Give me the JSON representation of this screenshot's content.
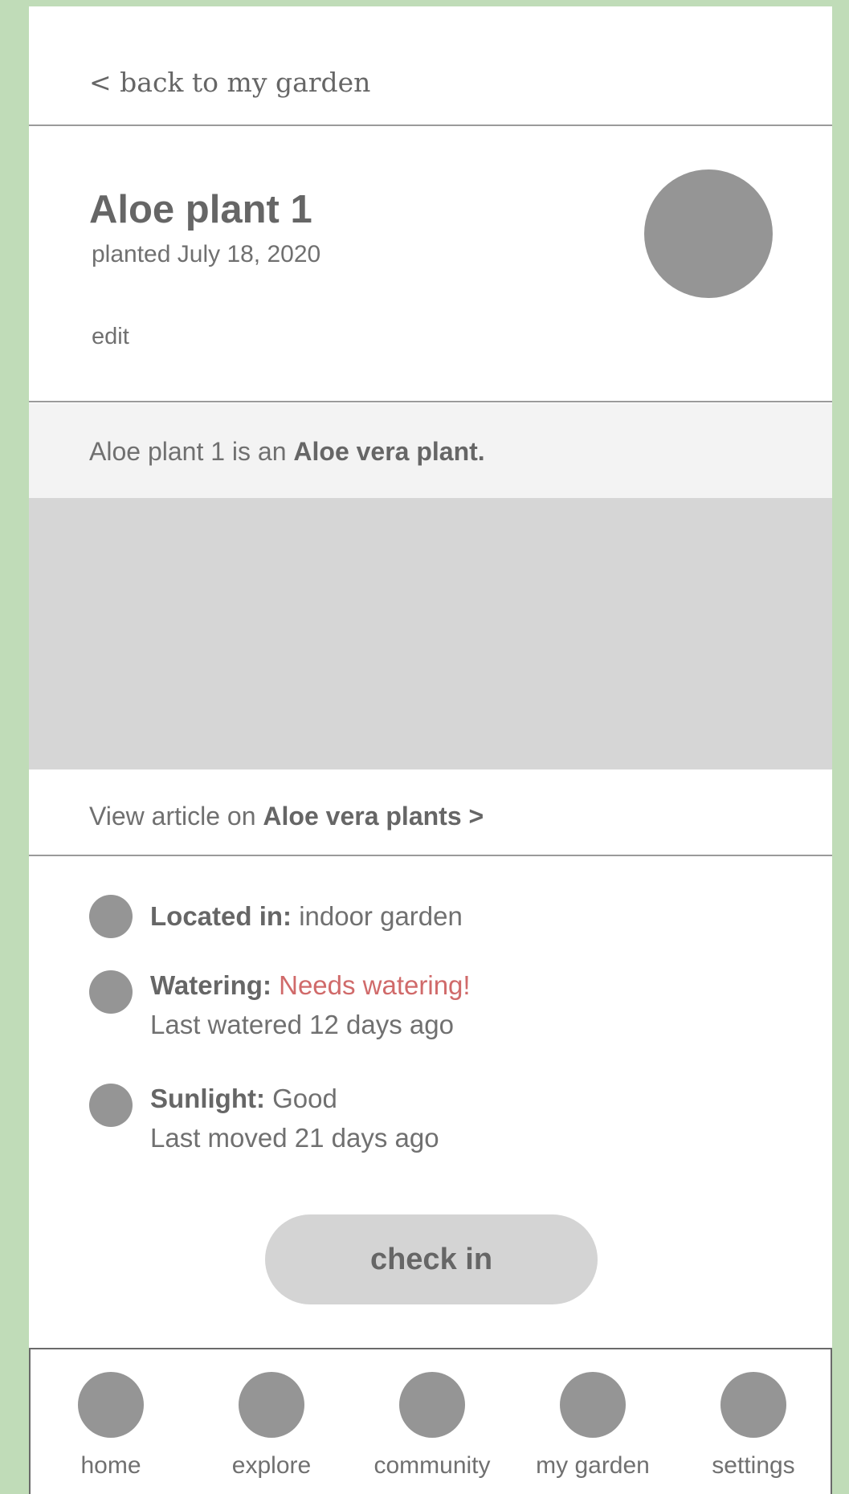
{
  "nav_back": {
    "label": "< back to my garden"
  },
  "plant": {
    "name": "Aloe plant 1",
    "planted": "planted July 18, 2020",
    "edit_label": "edit",
    "species_prefix": "Aloe plant 1 is an",
    "species": "Aloe vera plant."
  },
  "article": {
    "prefix": "View article on",
    "link": "Aloe vera plants >"
  },
  "info": {
    "location": {
      "label": "Located in:",
      "value": "indoor garden"
    },
    "watering": {
      "label": "Watering:",
      "value": "Needs watering!",
      "detail": "Last watered 12 days ago"
    },
    "sunlight": {
      "label": "Sunlight:",
      "value": "Good",
      "detail": "Last moved 21 days ago"
    }
  },
  "checkin_label": "check in",
  "bottom_nav": {
    "items": [
      {
        "label": "home",
        "icon": "home-icon"
      },
      {
        "label": "explore",
        "icon": "explore-icon"
      },
      {
        "label": "community",
        "icon": "community-icon"
      },
      {
        "label": "my garden",
        "icon": "my-garden-icon"
      },
      {
        "label": "settings",
        "icon": "settings-icon"
      }
    ]
  },
  "colors": {
    "background": "#c0dcb8",
    "alert": "#d06a6a",
    "placeholder": "#959595"
  }
}
